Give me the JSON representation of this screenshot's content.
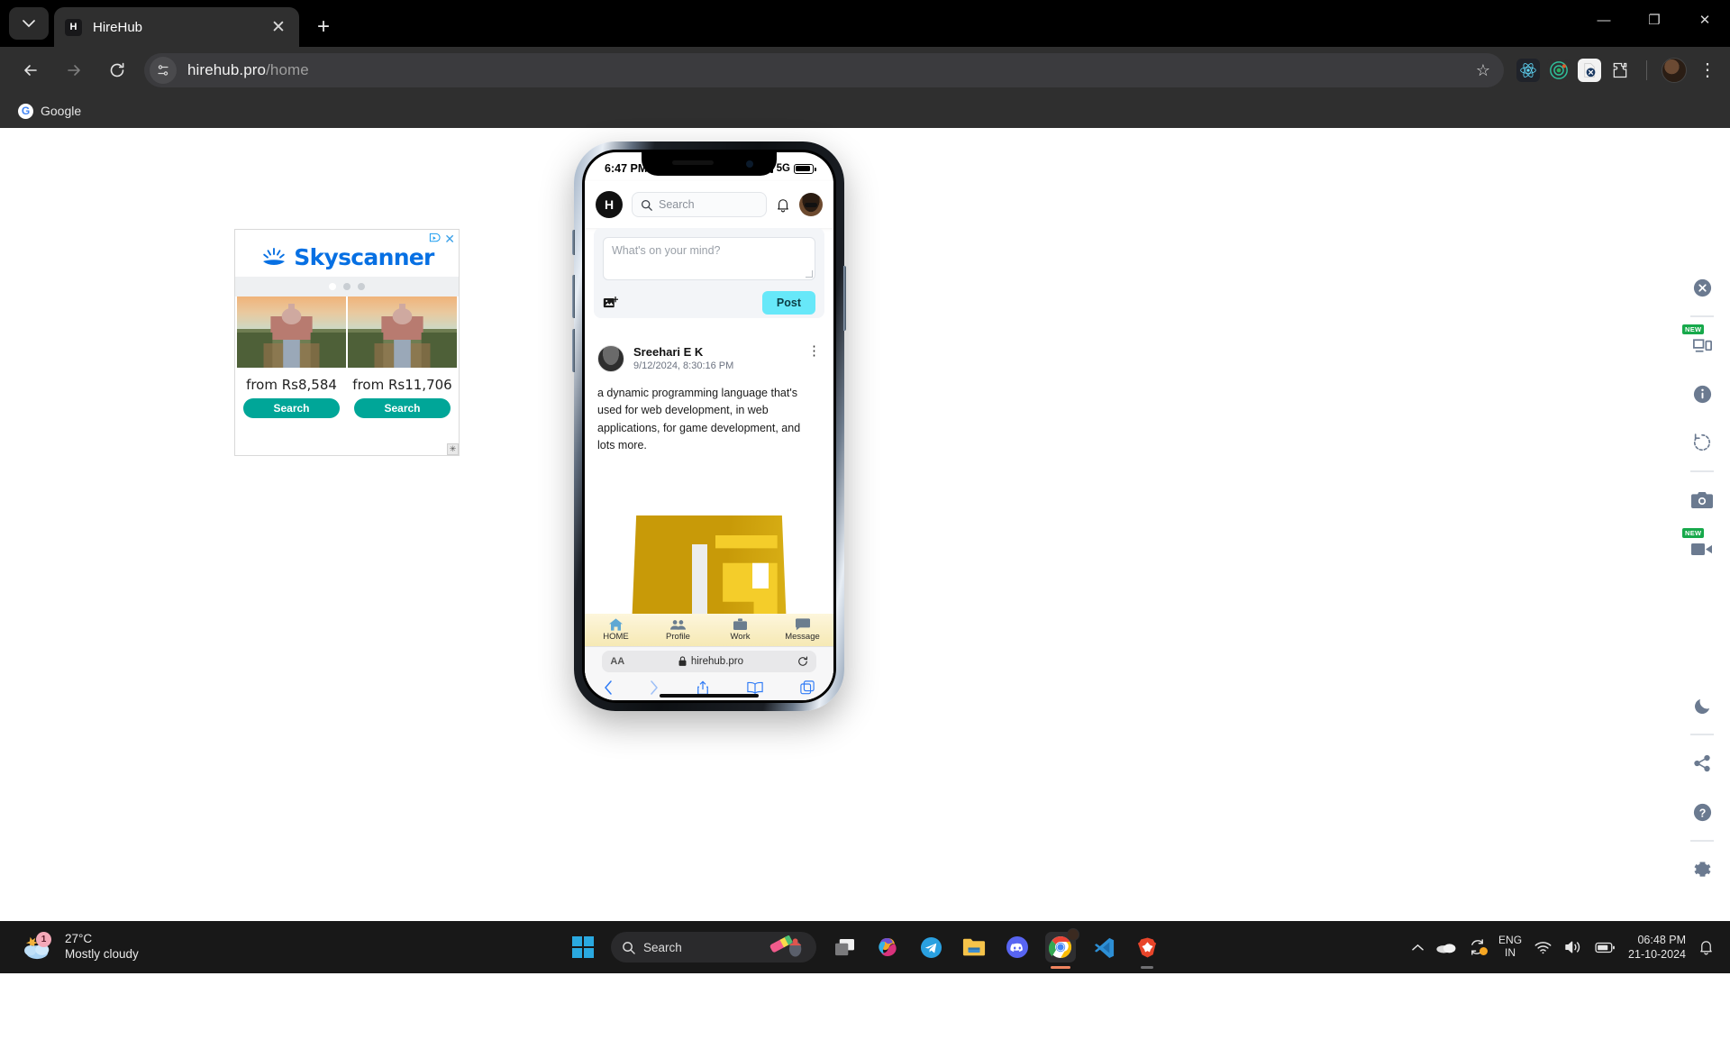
{
  "browser": {
    "tab": {
      "title": "HireHub",
      "favicon_letter": "H",
      "close_label": "✕"
    },
    "new_tab_label": "+",
    "window_controls": {
      "minimize": "—",
      "maximize": "❐",
      "close": "✕"
    },
    "omnibox": {
      "host": "hirehub.pro",
      "path": "/home"
    },
    "bookmarks": [
      {
        "label": "Google",
        "icon": "google-icon",
        "letter": "G"
      }
    ],
    "extensions": [
      "react-devtools-icon",
      "ring-tracker-icon",
      "docx-converter-icon",
      "puzzle-extensions-icon"
    ],
    "star_icon": "☆"
  },
  "ad": {
    "brand": "Skyscanner",
    "adchoices_label": "AdChoices",
    "close_label": "✕",
    "cards": [
      {
        "price": "from Rs8,584",
        "button": "Search"
      },
      {
        "price": "from Rs11,706",
        "button": "Search"
      }
    ],
    "corner_label": "✳",
    "accent_blue": "#0770e3",
    "button_green": "#00a698"
  },
  "phone": {
    "status": {
      "time": "6:47 PM",
      "network": "5G"
    },
    "app": {
      "logo_letter": "H",
      "search_placeholder": "Search",
      "bell_icon": "bell-icon",
      "avatar_icon": "user-avatar"
    },
    "composer": {
      "placeholder": "What's on your mind?",
      "image_button_icon": "add-image-icon",
      "post_label": "Post",
      "post_color": "#67e8f9"
    },
    "post": {
      "author": "Sreehari E K",
      "timestamp": "9/12/2024, 8:30:16 PM",
      "menu_icon": "kebab-menu-icon",
      "body": "a dynamic programming language that's used for web development, in web applications, for game development, and lots more.",
      "image_alt": "javascript-logo"
    },
    "tabbar": [
      {
        "label": "HOME",
        "icon": "home-icon"
      },
      {
        "label": "Profile",
        "icon": "people-icon"
      },
      {
        "label": "Work",
        "icon": "briefcase-icon"
      },
      {
        "label": "Message",
        "icon": "message-icon"
      }
    ],
    "safari": {
      "aa_label": "AA",
      "lock_icon": "lock-icon",
      "url": "hirehub.pro",
      "reload_icon": "reload-icon",
      "nav": [
        "back-icon",
        "forward-icon",
        "share-icon",
        "bookmarks-icon",
        "tabs-icon"
      ]
    }
  },
  "rail": {
    "items": [
      {
        "icon": "close-circle-icon",
        "badge": ""
      },
      {
        "icon": "responsive-devices-icon",
        "badge": "NEW"
      },
      {
        "icon": "info-icon",
        "badge": ""
      },
      {
        "icon": "rotate-icon",
        "badge": ""
      },
      {
        "icon": "camera-icon",
        "badge": ""
      },
      {
        "icon": "video-camera-icon",
        "badge": "NEW"
      },
      {
        "icon": "dark-mode-icon",
        "badge": ""
      },
      {
        "icon": "share-icon",
        "badge": ""
      },
      {
        "icon": "help-icon",
        "badge": ""
      },
      {
        "icon": "settings-gear-icon",
        "badge": ""
      }
    ]
  },
  "taskbar": {
    "weather": {
      "temperature": "27°C",
      "condition": "Mostly cloudy",
      "badge": "1"
    },
    "search_placeholder": "Search",
    "apps": [
      {
        "name": "start-windows-button"
      },
      {
        "name": "task-view-button"
      },
      {
        "name": "microsoft-copilot-button"
      },
      {
        "name": "telegram-button"
      },
      {
        "name": "file-explorer-button"
      },
      {
        "name": "discord-button"
      },
      {
        "name": "google-chrome-button"
      },
      {
        "name": "vs-code-button"
      },
      {
        "name": "brave-browser-button"
      }
    ],
    "tray": {
      "language": "ENG",
      "region": "IN",
      "time": "06:48 PM",
      "date": "21-10-2024",
      "icons": [
        "chevron-up-icon",
        "onedrive-icon",
        "sync-icon",
        "wifi-icon",
        "volume-icon",
        "battery-icon",
        "notifications-bell-icon"
      ]
    }
  }
}
